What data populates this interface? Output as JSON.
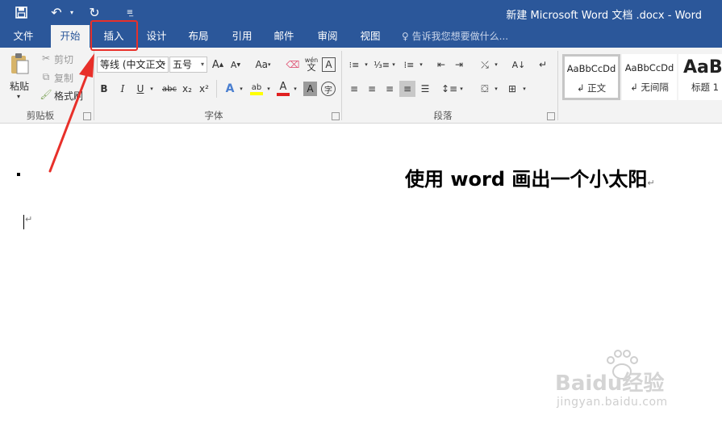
{
  "titlebar": {
    "doc_title": "新建 Microsoft Word 文档 .docx - Word",
    "qat": {
      "undo": "↶",
      "redo": "↻"
    }
  },
  "tabs": [
    {
      "label": "文件"
    },
    {
      "label": "开始",
      "active": true
    },
    {
      "label": "插入"
    },
    {
      "label": "设计"
    },
    {
      "label": "布局"
    },
    {
      "label": "引用"
    },
    {
      "label": "邮件"
    },
    {
      "label": "审阅"
    },
    {
      "label": "视图"
    }
  ],
  "tell_me": "告诉我您想要做什么...",
  "clipboard": {
    "paste": "粘贴",
    "cut": "剪切",
    "copy": "复制",
    "format_painter": "格式刷",
    "group_label": "剪贴板"
  },
  "font": {
    "font_name": "等线 (中文正文",
    "font_size": "五号",
    "grow": "A",
    "shrink": "A",
    "change_case": "Aa",
    "phonetic": "wén",
    "bold": "B",
    "italic": "I",
    "underline": "U",
    "strike": "abc",
    "subscript": "x₂",
    "superscript": "x²",
    "text_effects": "A",
    "font_color": "A",
    "char_shading": "A",
    "enclose": "字",
    "group_label": "字体"
  },
  "paragraph": {
    "group_label": "段落"
  },
  "styles": [
    {
      "sample": "AaBbCcDd",
      "name": "↲ 正文"
    },
    {
      "sample": "AaBbCcDd",
      "name": "↲ 无间隔"
    },
    {
      "sample": "AaBl",
      "name": "标题 1"
    }
  ],
  "document": {
    "heading": "使用 word 画出一个小太阳"
  },
  "watermark": {
    "brand": "Baidu经验",
    "url": "jingyan.baidu.com"
  },
  "colors": {
    "accent": "#2b579a",
    "annotation": "#e8302a",
    "highlight_yellow": "#ffff00",
    "font_red": "#e02020"
  }
}
